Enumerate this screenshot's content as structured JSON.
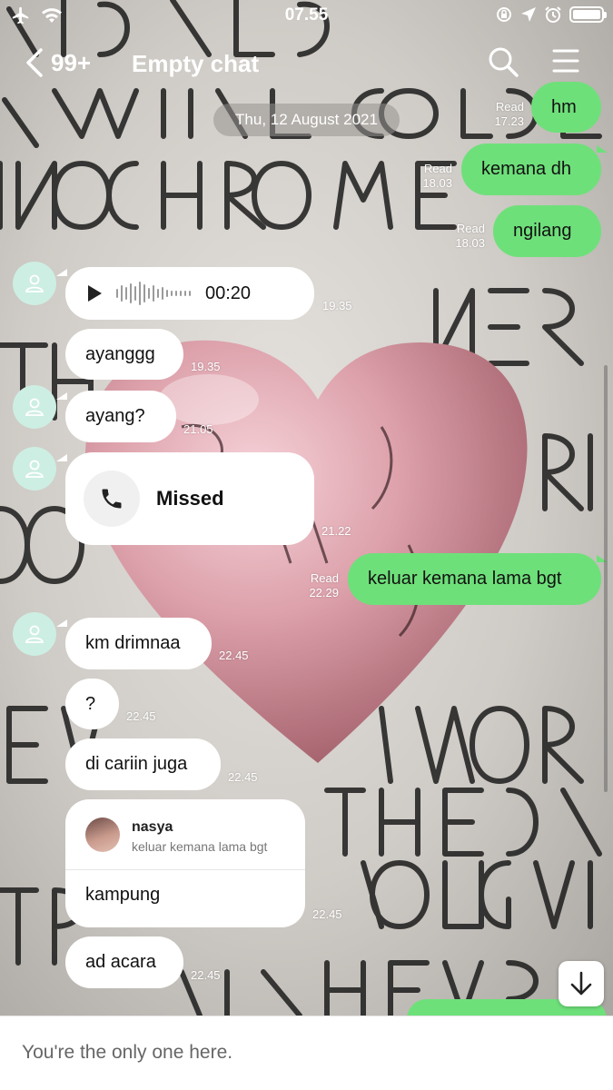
{
  "status_bar": {
    "time": "07.55",
    "battery_level": 1.0
  },
  "header": {
    "unread_count": "99+",
    "title": "Empty chat"
  },
  "date_separator": "Thu, 12 August 2021",
  "messages": [
    {
      "kind": "text",
      "side": "out",
      "text": "hm",
      "status": "Read",
      "time": "17.23"
    },
    {
      "kind": "text",
      "side": "out",
      "text": "kemana dh",
      "status": "Read",
      "time": "18.03"
    },
    {
      "kind": "text",
      "side": "out",
      "text": "ngilang",
      "status": "Read",
      "time": "18.03"
    },
    {
      "kind": "voice",
      "side": "in",
      "duration": "00:20",
      "time": "19.35"
    },
    {
      "kind": "text",
      "side": "in",
      "text": "ayanggg",
      "time": "19.35"
    },
    {
      "kind": "text",
      "side": "in",
      "text": "ayang?",
      "time": "21.05"
    },
    {
      "kind": "call",
      "side": "in",
      "text": "Missed",
      "time": "21.22"
    },
    {
      "kind": "text",
      "side": "out",
      "text": "keluar kemana lama bgt",
      "status": "Read",
      "time": "22.29"
    },
    {
      "kind": "text",
      "side": "in",
      "text": "km drimnaa",
      "time": "22.45"
    },
    {
      "kind": "text",
      "side": "in",
      "text": "?",
      "time": "22.45"
    },
    {
      "kind": "text",
      "side": "in",
      "text": "di cariin juga",
      "time": "22.45"
    },
    {
      "kind": "reply",
      "side": "in",
      "reply_to_name": "nasya",
      "reply_to_text": "keluar kemana lama bgt",
      "text": "kampung",
      "time": "22.45"
    },
    {
      "kind": "text",
      "side": "in",
      "text": "ad acara",
      "time": "22.45"
    }
  ],
  "footer": {
    "notice": "You're the only one here."
  },
  "icons": {
    "status_left": [
      "airplane-icon",
      "wifi-icon"
    ],
    "status_right": [
      "rotation-lock-icon",
      "location-icon",
      "alarm-icon",
      "battery-icon"
    ],
    "header": [
      "back-chevron-icon",
      "search-icon",
      "menu-icon"
    ],
    "other": [
      "play-icon",
      "phone-icon",
      "person-icon",
      "arrow-down-icon"
    ]
  },
  "colors": {
    "outgoing_bubble": "#6ee07a",
    "incoming_bubble": "#ffffff",
    "avatar_bg": "#cdeee3"
  }
}
